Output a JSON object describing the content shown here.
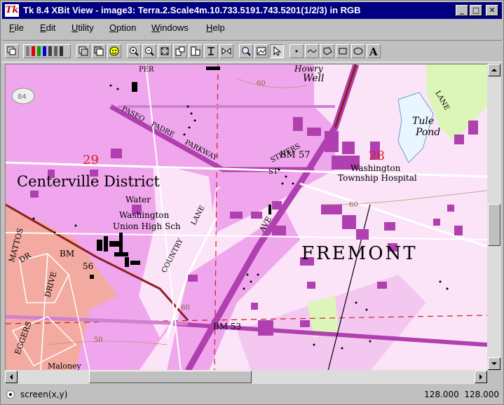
{
  "window": {
    "logo": "Tk",
    "title": "Tk 8.4 XBit View - image3: Terra.2.Scale4m.10.733.5191.743.5201(1/2/3)  in RGB",
    "minimize": "_",
    "maximize": "□",
    "close": "✕"
  },
  "menu": [
    {
      "label": "File",
      "key": "F",
      "rest": "ile"
    },
    {
      "label": "Edit",
      "key": "E",
      "rest": "dit"
    },
    {
      "label": "Utility",
      "key": "U",
      "rest": "tility"
    },
    {
      "label": "Option",
      "key": "O",
      "rest": "ption"
    },
    {
      "label": "Windows",
      "key": "W",
      "rest": "indows"
    },
    {
      "label": "Help",
      "key": "H",
      "rest": "elp"
    }
  ],
  "toolbar": {
    "icons": [
      "copy-image-icon",
      "rgb-channels-icon",
      "layer-1-icon",
      "layer-2-icon",
      "smiley-icon",
      "zoom-in-icon",
      "zoom-out-icon",
      "fit-icon",
      "rotate-icon",
      "flip-icon",
      "transpose-icon",
      "mirror-icon",
      "magnifier-icon",
      "landscape-icon",
      "pointer-icon",
      "point-icon",
      "line-icon",
      "polygon-icon",
      "rectangle-icon",
      "ellipse-icon",
      "text-icon"
    ]
  },
  "map": {
    "labels": {
      "per": "PER",
      "well": "Well",
      "howry": "Howry",
      "lane_ne": "LANE",
      "tule": "Tule",
      "pond": "Pond",
      "paseo": "PASEO",
      "padre": "PADRE",
      "parkway": "PARKWAY",
      "bm57": "BM 57",
      "stivers": "STIVERS",
      "st": "ST",
      "sec28": "28",
      "wash_hosp_1": "Washington",
      "wash_hosp_2": "Township Hospital",
      "sec29": "29",
      "centerville": "Centerville District",
      "water": "Water",
      "wash_hs_1": "Washington",
      "wash_hs_2": "Union High Sch",
      "ave": "AVE",
      "country": "COUNTRY",
      "lane": "LANE",
      "fremont": "FREMONT",
      "c60a": "60",
      "c60b": "60",
      "c60c": "60",
      "c50": "50",
      "mattos": "MATTOS",
      "dr": "DR",
      "drive": "DRIVE",
      "bm56a": "BM",
      "bm56b": "56",
      "eggers": "EGGERS",
      "bm53": "BM 53",
      "maloney": "Maloney",
      "route84": "84"
    }
  },
  "status": {
    "mode": "screen(x,y)",
    "coords": "128.000  128.000"
  },
  "colors": {
    "title_bg": "#000080",
    "urban_pink": "#f0a6ec",
    "building_purple": "#b040b0",
    "salmon": "#f3aaa0",
    "grid_red": "#d02020",
    "brown": "#8b2020"
  }
}
